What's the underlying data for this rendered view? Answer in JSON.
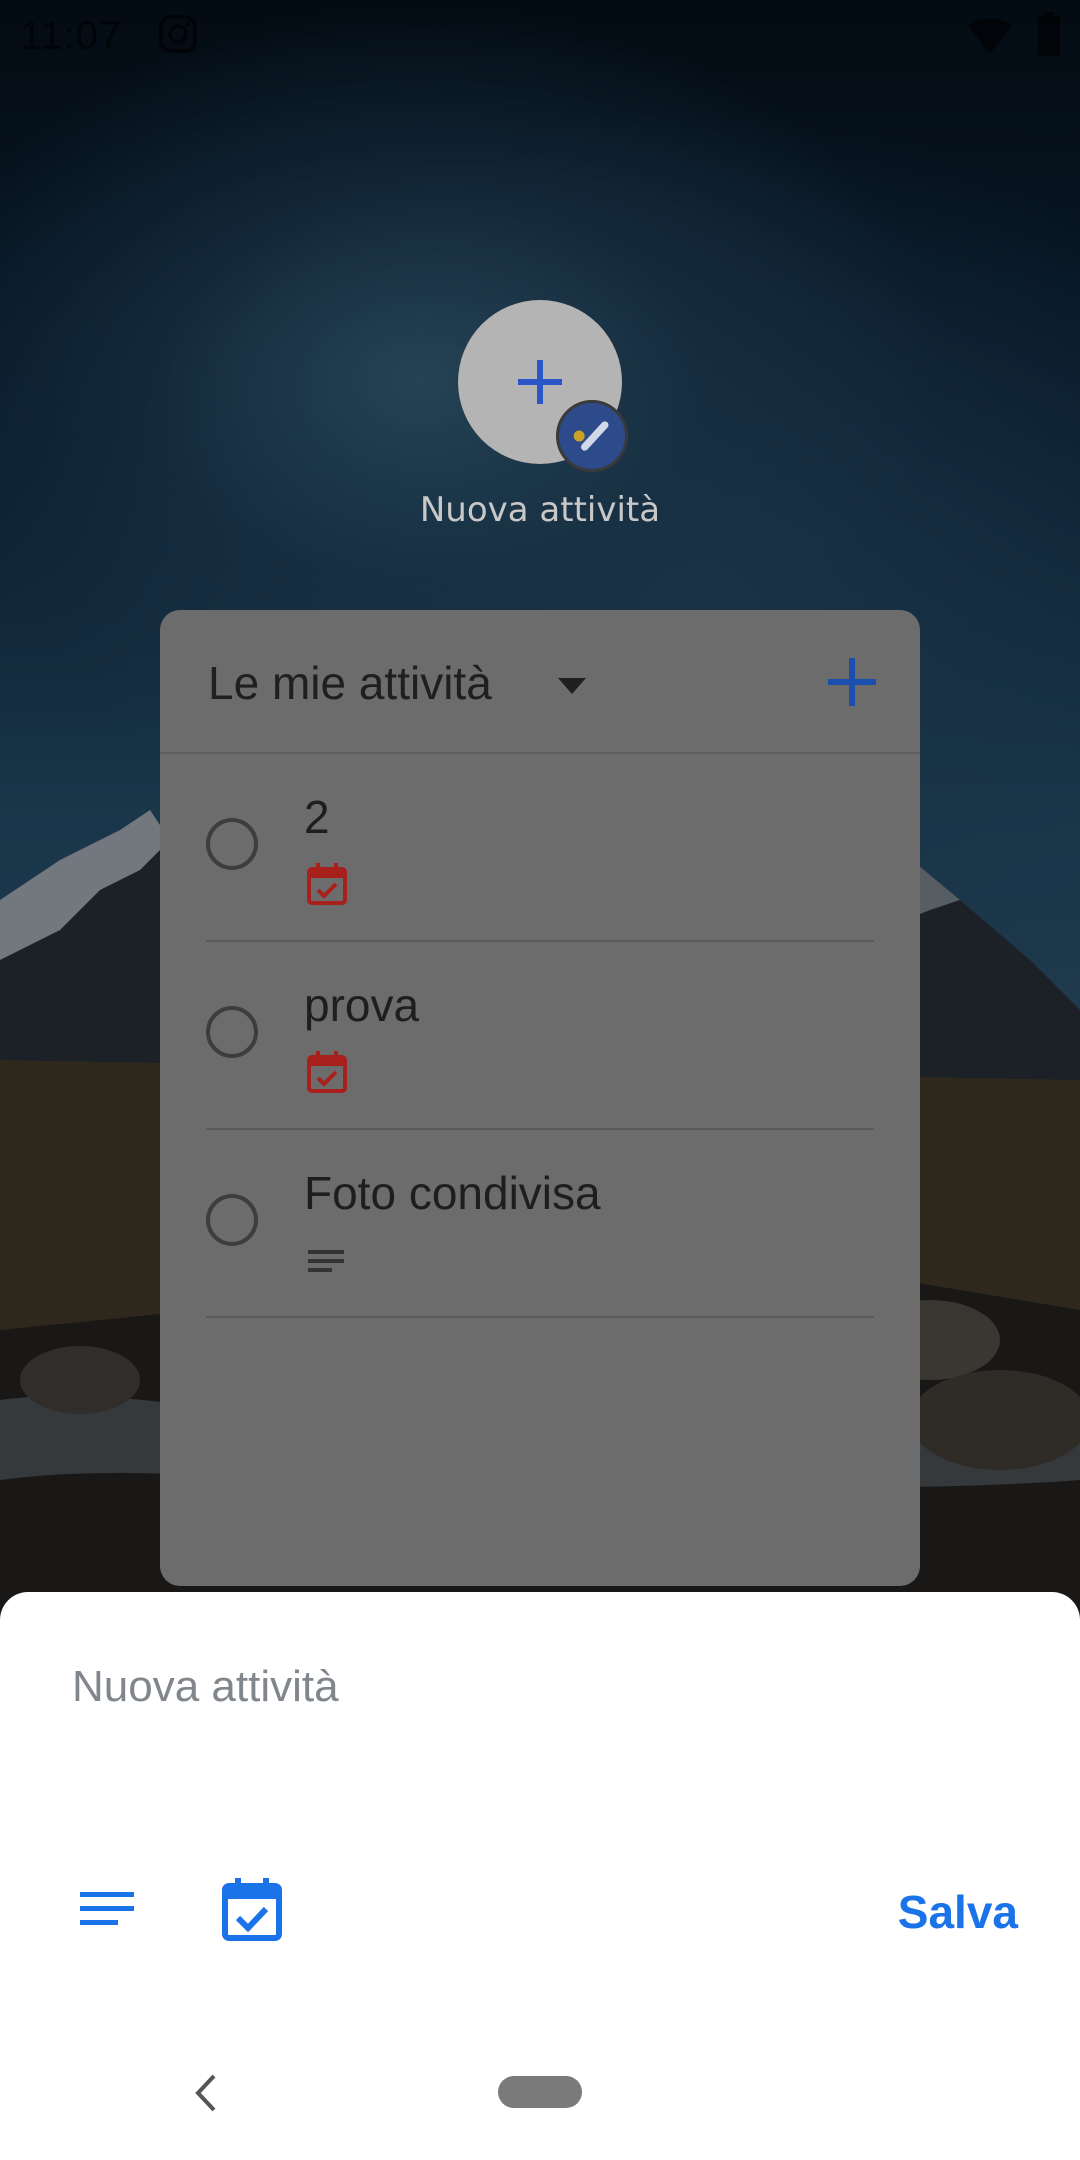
{
  "status_bar": {
    "time": "11:07",
    "icons": [
      "instagram-icon",
      "wifi-icon",
      "battery-icon"
    ]
  },
  "shortcut": {
    "label": "Nuova attività",
    "icon": "plus-icon",
    "badge_icon": "tasks-app-badge-icon"
  },
  "widget": {
    "title": "Le mie attività",
    "dropdown_icon": "caret-down-icon",
    "add_icon": "plus-icon",
    "tasks": [
      {
        "title": "2",
        "icon": "calendar-check-icon",
        "icon_color": "#c5221f"
      },
      {
        "title": "prova",
        "icon": "calendar-check-icon",
        "icon_color": "#c5221f"
      },
      {
        "title": "Foto condivisa",
        "icon": "notes-icon",
        "icon_color": "#3d3d3d"
      }
    ]
  },
  "sheet": {
    "input_value": "",
    "input_placeholder": "Nuova attività",
    "details_icon": "notes-icon",
    "date_icon": "calendar-check-icon",
    "save_label": "Salva"
  },
  "nav_bar": {
    "icons": [
      "back-icon",
      "home-pill"
    ]
  },
  "colors": {
    "accent": "#1a73e8",
    "due_date": "#c5221f",
    "sheet_background": "#ffffff"
  }
}
